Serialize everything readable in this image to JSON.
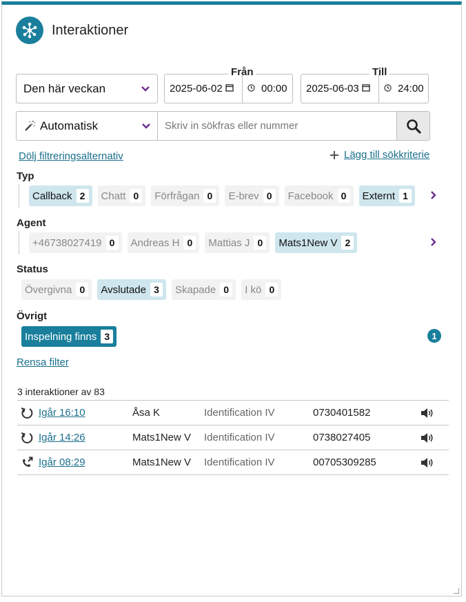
{
  "header": {
    "title": "Interaktioner"
  },
  "period": {
    "selected": "Den här veckan"
  },
  "from": {
    "label": "Från",
    "date": "2025-06-02",
    "time": "00:00"
  },
  "to": {
    "label": "Till",
    "date": "2025-06-03",
    "time": "24:00"
  },
  "search": {
    "mode": "Automatisk",
    "placeholder": "Skriv in sökfras eller nummer"
  },
  "links": {
    "hide_filters": "Dölj filtreringsalternativ",
    "add_criteria": "Lägg till sökkriterie",
    "clear_filter": "Rensa filter"
  },
  "filters": {
    "type": {
      "label": "Typ",
      "chips": [
        {
          "label": "Callback",
          "count": "2",
          "active": true
        },
        {
          "label": "Chatt",
          "count": "0",
          "active": false
        },
        {
          "label": "Förfrågan",
          "count": "0",
          "active": false
        },
        {
          "label": "E-brev",
          "count": "0",
          "active": false
        },
        {
          "label": "Facebook",
          "count": "0",
          "active": false
        },
        {
          "label": "Externt",
          "count": "1",
          "active": true
        }
      ]
    },
    "agent": {
      "label": "Agent",
      "chips": [
        {
          "label": "+46738027419",
          "count": "0",
          "active": false
        },
        {
          "label": "Andreas H",
          "count": "0",
          "active": false
        },
        {
          "label": "Mattias J",
          "count": "0",
          "active": false
        },
        {
          "label": "Mats1New V",
          "count": "2",
          "active": true
        }
      ]
    },
    "status": {
      "label": "Status",
      "chips": [
        {
          "label": "Övergivna",
          "count": "0",
          "active": false
        },
        {
          "label": "Avslutade",
          "count": "3",
          "active": true
        },
        {
          "label": "Skapade",
          "count": "0",
          "active": false
        },
        {
          "label": "I kö",
          "count": "0",
          "active": false
        }
      ]
    },
    "other": {
      "label": "Övrigt",
      "chips": [
        {
          "label": "Inspelning finns",
          "count": "3",
          "active": true
        }
      ],
      "badge": "1"
    }
  },
  "results": {
    "summary": "3 interaktioner av 83",
    "rows": [
      {
        "icon": "callback-icon",
        "time": "Igår 16:10",
        "agent": "Åsa K",
        "queue": "Identification IV",
        "number": "0730401582"
      },
      {
        "icon": "callback-icon",
        "time": "Igår 14:26",
        "agent": "Mats1New V",
        "queue": "Identification IV",
        "number": "0738027405"
      },
      {
        "icon": "outgoing-call-icon",
        "time": "Igår 08:29",
        "agent": "Mats1New V",
        "queue": "Identification IV",
        "number": "00705309285"
      }
    ]
  },
  "colors": {
    "accent": "#1a7f9c",
    "chip_active": "#cfe6ee",
    "chevron": "#6a2d91"
  }
}
